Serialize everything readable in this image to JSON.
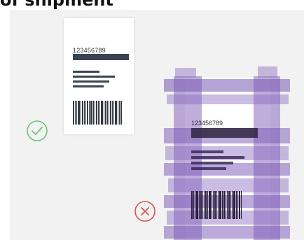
{
  "heading": "of shipment",
  "good_label": {
    "tracking_number": "123456789"
  },
  "bad_label": {
    "tracking_number": "123456789"
  },
  "icons": {
    "ok": "check-circle-icon",
    "bad": "x-circle-icon"
  },
  "colors": {
    "ok": "#5cb85c",
    "bad": "#d9534f",
    "tape": "#8a6bbf",
    "label_text": "#3c4350"
  }
}
